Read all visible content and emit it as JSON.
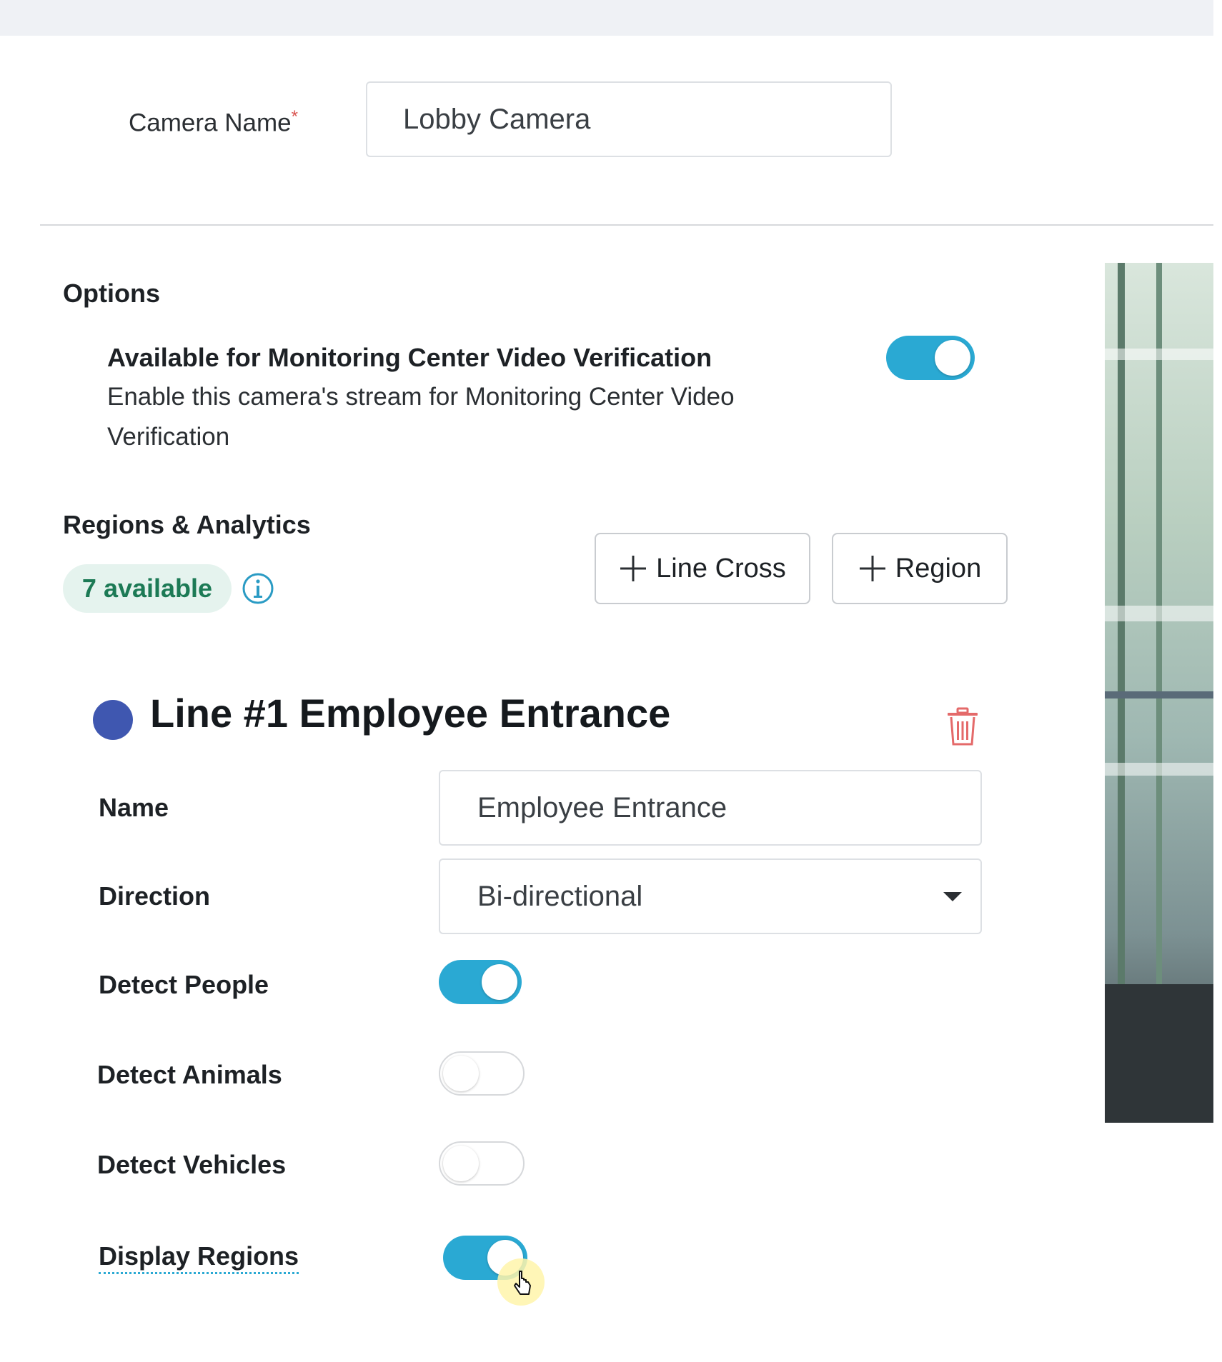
{
  "camera": {
    "name_label": "Camera Name",
    "required_marker": "*",
    "name_value": "Lobby Camera"
  },
  "options": {
    "section_title": "Options",
    "video_verification": {
      "title": "Available for Monitoring Center Video Verification",
      "description": "Enable this camera's stream for Monitoring Center Video Verification",
      "enabled": true
    }
  },
  "regions": {
    "section_title": "Regions & Analytics",
    "available_badge": "7 available",
    "add_line_cross_label": "Line Cross",
    "add_region_label": "Region"
  },
  "line": {
    "title": "Line #1 Employee Entrance",
    "color": "#3f57b0",
    "name_label": "Name",
    "name_value": "Employee Entrance",
    "direction_label": "Direction",
    "direction_value": "Bi-directional",
    "toggles": [
      {
        "label": "Detect People",
        "enabled": true
      },
      {
        "label": "Detect Animals",
        "enabled": false
      },
      {
        "label": "Detect Vehicles",
        "enabled": false
      },
      {
        "label": "Display Regions",
        "enabled": true
      }
    ]
  },
  "colors": {
    "accent": "#2aa9d3",
    "badge_bg": "#e5f3ee",
    "badge_text": "#1c7a55",
    "delete": "#e46a6a"
  }
}
